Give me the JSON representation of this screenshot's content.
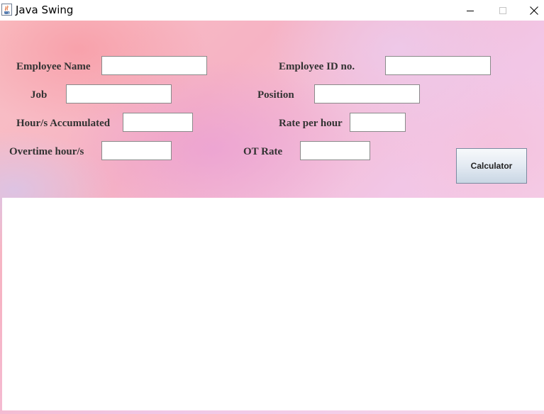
{
  "window": {
    "title": "Java Swing",
    "icon": "java-cup-icon",
    "controls": [
      "minimize-icon",
      "maximize-icon",
      "close-icon"
    ]
  },
  "form": {
    "employee_name": {
      "label": "Employee Name",
      "value": ""
    },
    "employee_id": {
      "label": "Employee ID no.",
      "value": ""
    },
    "job": {
      "label": "Job",
      "value": ""
    },
    "position": {
      "label": "Position",
      "value": ""
    },
    "hours_accumulated": {
      "label": "Hour/s Accumulated",
      "value": ""
    },
    "rate_per_hour": {
      "label": "Rate per hour",
      "value": ""
    },
    "overtime_hours": {
      "label": "Overtime hour/s",
      "value": ""
    },
    "ot_rate": {
      "label": "OT Rate",
      "value": ""
    }
  },
  "actions": {
    "calculator_label": "Calculator"
  },
  "output": {
    "text": ""
  },
  "colors": {
    "label_text": "#333333",
    "field_border": "#8a8a8a",
    "background_pink": "#f6b3c4",
    "background_lavender": "#f2c6e6"
  }
}
